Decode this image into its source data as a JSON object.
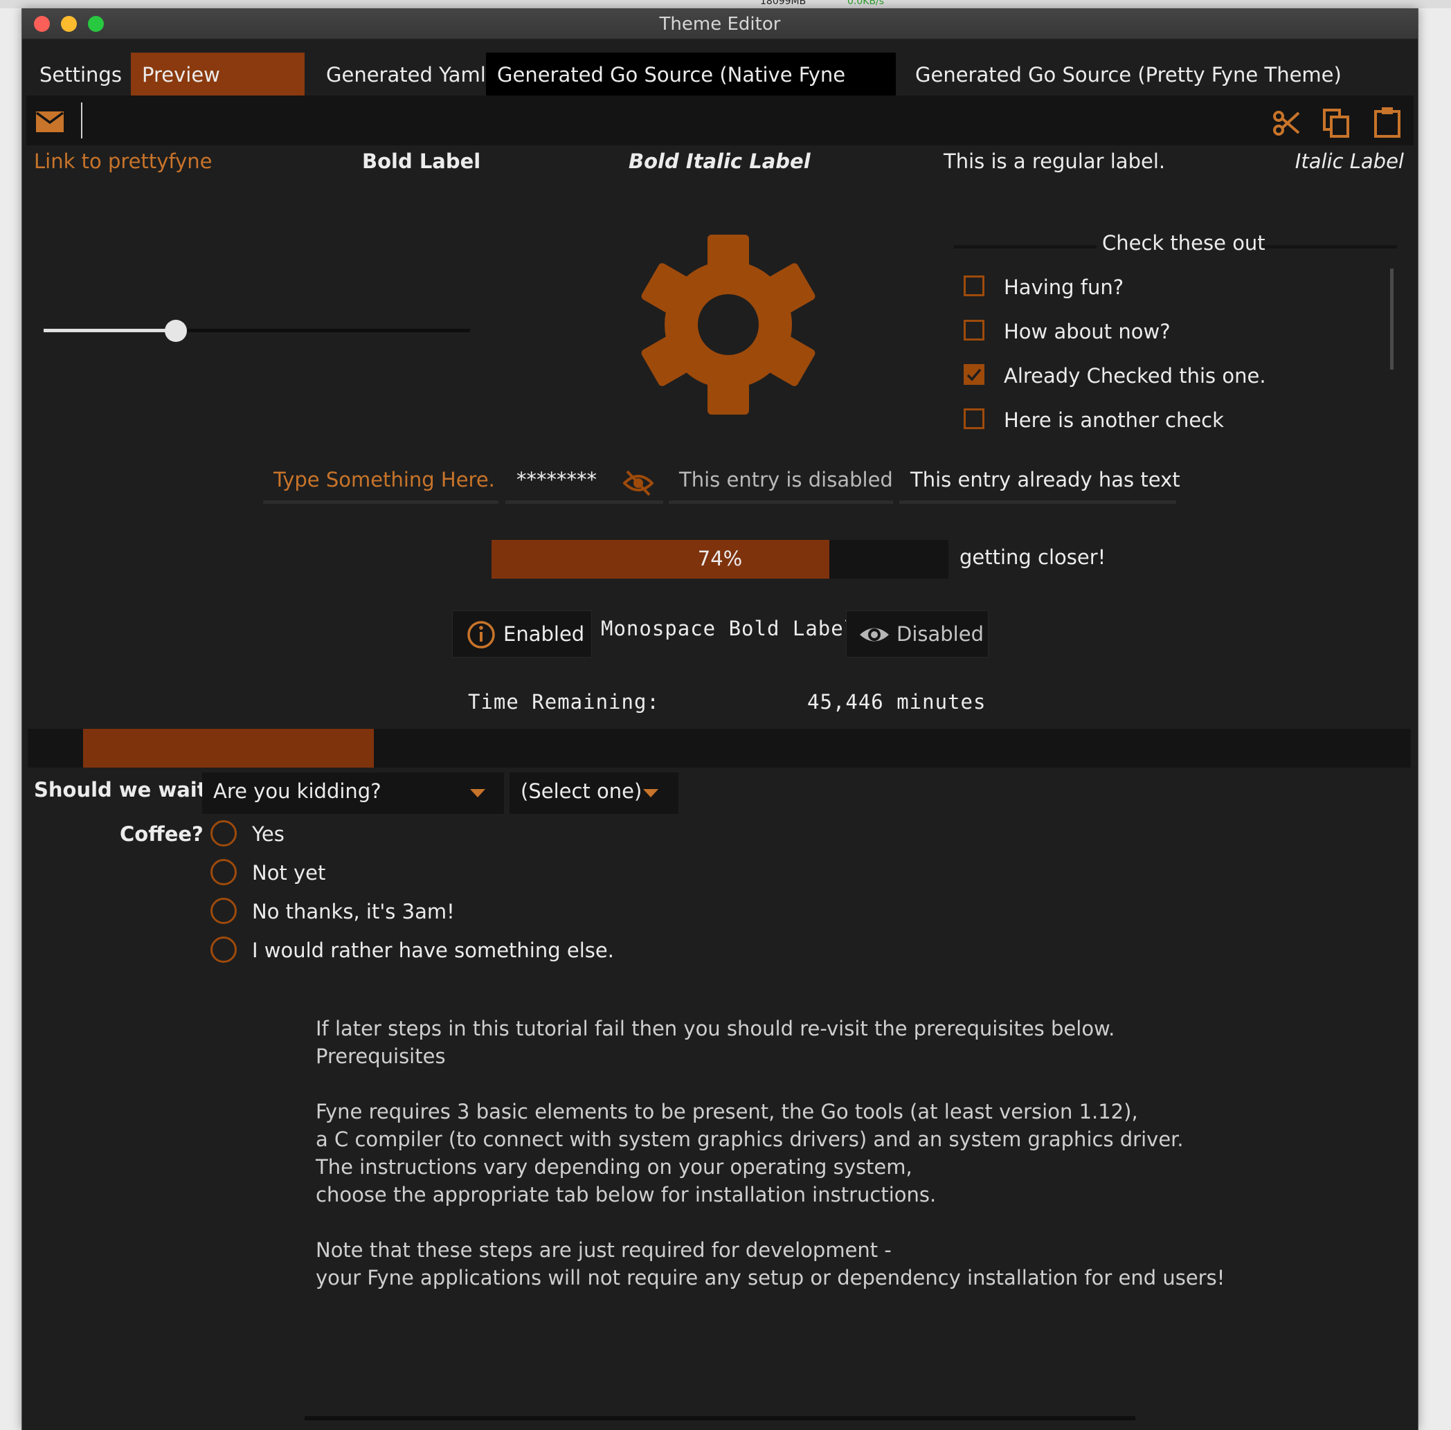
{
  "window": {
    "title": "Theme Editor"
  },
  "tabs": [
    {
      "label": "Settings"
    },
    {
      "label": "Preview Widgets"
    },
    {
      "label": "Generated Yaml"
    },
    {
      "label": "Generated Go Source (Native Fyne Theme)"
    },
    {
      "label": "Generated Go Source (Pretty Fyne Theme)"
    }
  ],
  "toolbar": {
    "left_icon": "mail-icon",
    "right_icons": [
      "cut-icon",
      "copy-icon",
      "paste-icon"
    ]
  },
  "labels": {
    "link": "Link to prettyfyne",
    "bold": "Bold Label",
    "bold_italic": "Bold Italic Label",
    "regular": "This is a regular label.",
    "italic": "Italic Label"
  },
  "slider": {
    "value_fraction": 0.31
  },
  "center_icon": "gear-icon",
  "checks": {
    "title": "Check these out",
    "items": [
      {
        "label": "Having fun?",
        "checked": false
      },
      {
        "label": "How about now?",
        "checked": false
      },
      {
        "label": "Already Checked this one.",
        "checked": true
      },
      {
        "label": "Here is another check",
        "checked": false
      }
    ]
  },
  "entries": {
    "placeholder": "Type Something Here.",
    "password": "********",
    "disabled": "This entry is disabled",
    "with_text": "This entry already has text"
  },
  "progress": {
    "value_text": "74%",
    "value_fraction": 0.74,
    "label": "getting closer!"
  },
  "buttons": {
    "enabled": "Enabled",
    "monospace_label": "Monospace Bold Label",
    "disabled": "Disabled"
  },
  "time": {
    "label": "Time Remaining:",
    "value": "45,446 minutes"
  },
  "time_bar": {
    "fill_fraction": 0.21
  },
  "wait": {
    "label": "Should we wait?",
    "select1": "Are you kidding?",
    "select2": "(Select one)"
  },
  "coffee": {
    "label": "Coffee?",
    "options": [
      "Yes",
      "Not yet",
      "No thanks, it's 3am!",
      "I would rather have something else."
    ]
  },
  "paragraph": [
    "If later steps in this tutorial fail then you should re-visit the prerequisites below.",
    "Prerequisites",
    "",
    "Fyne requires 3 basic elements to be present, the Go tools (at least version 1.12),",
    "a C compiler (to connect with system graphics drivers) and an system graphics driver.",
    "The instructions vary depending on your operating system,",
    "choose the appropriate tab below for installation instructions.",
    "",
    "Note that these steps are just required for development -",
    "your Fyne applications will not require any setup or dependency installation for end users!"
  ],
  "colors": {
    "accent": "#9e4a0b",
    "progress_fill": "#7f330d",
    "background": "#1e1e1e"
  }
}
